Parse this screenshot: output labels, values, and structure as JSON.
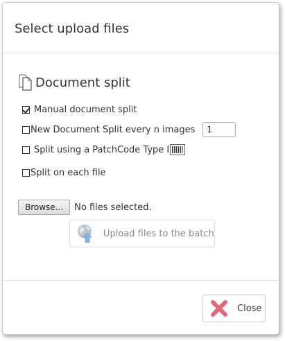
{
  "dialog": {
    "title": "Select upload files"
  },
  "section": {
    "title": "Document split",
    "icon": "document-pages-icon"
  },
  "options": {
    "manual_split": {
      "label": "Manual document split",
      "checked": true
    },
    "every_n": {
      "label": "New Document Split every n images",
      "checked": false,
      "value": "1"
    },
    "patchcode": {
      "label": "Split using a PatchCode Type I",
      "checked": false,
      "icon": "barcode-icon"
    },
    "each_file": {
      "label": "Split on each file",
      "checked": false
    }
  },
  "file_input": {
    "browse_label": "Browse...",
    "status": "No files selected."
  },
  "upload": {
    "label": "Upload files to the batch",
    "icon": "globe-upload-icon",
    "enabled": false
  },
  "footer": {
    "close_label": "Close",
    "close_icon": "red-x-icon"
  },
  "colors": {
    "close_x": "#e2687a",
    "upload_icon": "#4a90c8",
    "disabled_text": "#888888"
  }
}
